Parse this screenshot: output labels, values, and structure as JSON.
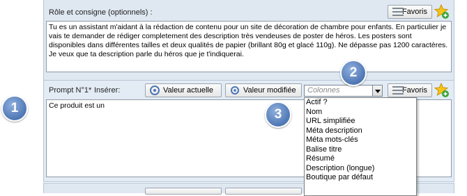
{
  "role_section": {
    "label": "Rôle et consigne (optionnels) :",
    "text": "Tu es un assistant m'aidant à la rédaction de contenu pour un site de décoration de chambre pour enfants. En particulier je vais te demander de rédiger completement des description très vendeuses de poster de héros. Les posters sont disponibles dans différentes tailles et deux qualités de papier (brillant 80g et glacé 110g). Ne dépasse pas 1200 caractères. Je veux que ta description parle du héros que je t'indiquerai.",
    "favoris_label": "Favoris"
  },
  "prompt_section": {
    "label": "Prompt N°1*",
    "insert_label": "Insérer:",
    "current_value_button": "Valeur actuelle",
    "modified_value_button": "Valeur modifiée",
    "columns_placeholder": "Colonnes",
    "favoris_label": "Favoris",
    "text": "Ce produit est un"
  },
  "dropdown": {
    "items": [
      "Actif ?",
      "Nom",
      "URL simplifiée",
      "Méta description",
      "Méta mots-clés",
      "Balise titre",
      "Résumé",
      "Description (longue)",
      "Boutique par défaut"
    ]
  },
  "badges": [
    "1",
    "2",
    "3"
  ],
  "colors": {
    "badge": "#4f77b4",
    "panel": "#dfe8f1"
  }
}
